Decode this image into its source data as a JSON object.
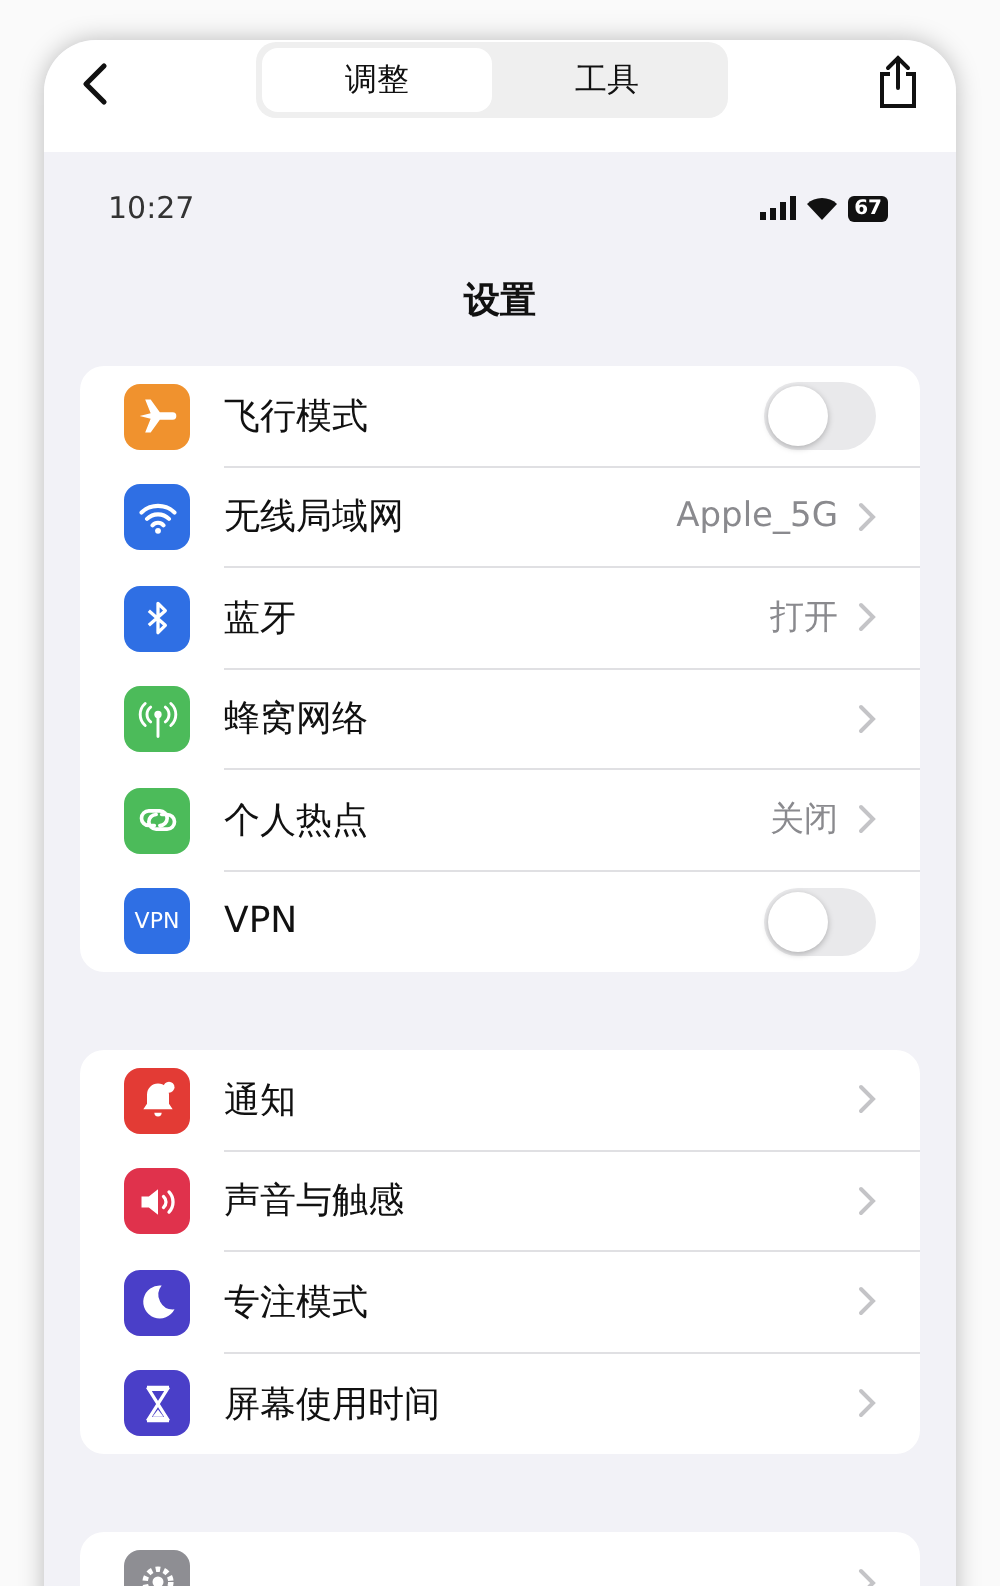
{
  "toolbar": {
    "tabs": [
      {
        "label": "调整",
        "selected": true
      },
      {
        "label": "工具",
        "selected": false
      }
    ]
  },
  "status_bar": {
    "time": "10:27",
    "battery": "67"
  },
  "title": "设置",
  "groups": [
    {
      "items": [
        {
          "kind": "toggle",
          "label": "飞行模式",
          "color": "#f0922e",
          "on": false
        },
        {
          "kind": "link",
          "label": "无线局域网",
          "color": "#2f6fe4",
          "value": "Apple_5G"
        },
        {
          "kind": "link",
          "label": "蓝牙",
          "color": "#2f6fe4",
          "value": "打开"
        },
        {
          "kind": "link",
          "label": "蜂窝网络",
          "color": "#4cbb5a"
        },
        {
          "kind": "link",
          "label": "个人热点",
          "color": "#4cbb5a",
          "value": "关闭"
        },
        {
          "kind": "toggle",
          "label": "VPN",
          "color": "#2f6fe4",
          "on": false,
          "icon_text": "VPN"
        }
      ]
    },
    {
      "items": [
        {
          "kind": "link",
          "label": "通知",
          "color": "#e33b35"
        },
        {
          "kind": "link",
          "label": "声音与触感",
          "color": "#e0324c"
        },
        {
          "kind": "link",
          "label": "专注模式",
          "color": "#4a3fc8"
        },
        {
          "kind": "link",
          "label": "屏幕使用时间",
          "color": "#4a3fc8"
        }
      ]
    },
    {
      "items": [
        {
          "kind": "link",
          "color": "#8e8e93"
        }
      ]
    }
  ]
}
